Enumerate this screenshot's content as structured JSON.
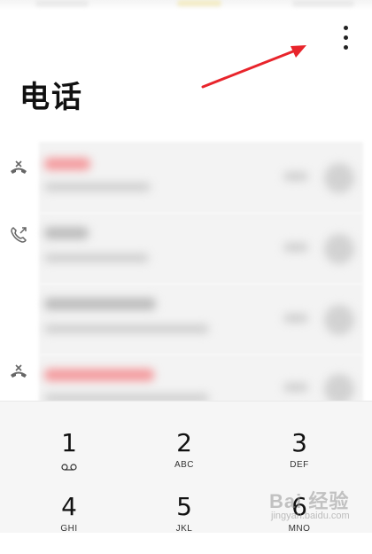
{
  "header": {
    "title": "电话",
    "more_icon": "more-vertical-icon"
  },
  "colors": {
    "accent_arrow": "#e8242b",
    "missed_blur": "#f37f82",
    "dialpad_bg": "#f6f6f6"
  },
  "call_log": [
    {
      "type_icon": "missed-call-icon",
      "name_color": "#f5a3a5"
    },
    {
      "type_icon": "outgoing-call-icon",
      "name_color": "#cccccc"
    },
    {
      "type_icon": "",
      "name_color": "#cccccc"
    },
    {
      "type_icon": "missed-call-icon",
      "name_color": "#f5a3a5"
    }
  ],
  "dialpad": {
    "keys": [
      {
        "digit": "1",
        "letters": "",
        "icon": "voicemail-icon"
      },
      {
        "digit": "2",
        "letters": "ABC"
      },
      {
        "digit": "3",
        "letters": "DEF"
      },
      {
        "digit": "4",
        "letters": "GHI"
      },
      {
        "digit": "5",
        "letters": "JKL"
      },
      {
        "digit": "6",
        "letters": "MNO"
      }
    ]
  },
  "watermark": {
    "logo": "Bai 经验",
    "sub": "jingyan.baidu.com"
  }
}
